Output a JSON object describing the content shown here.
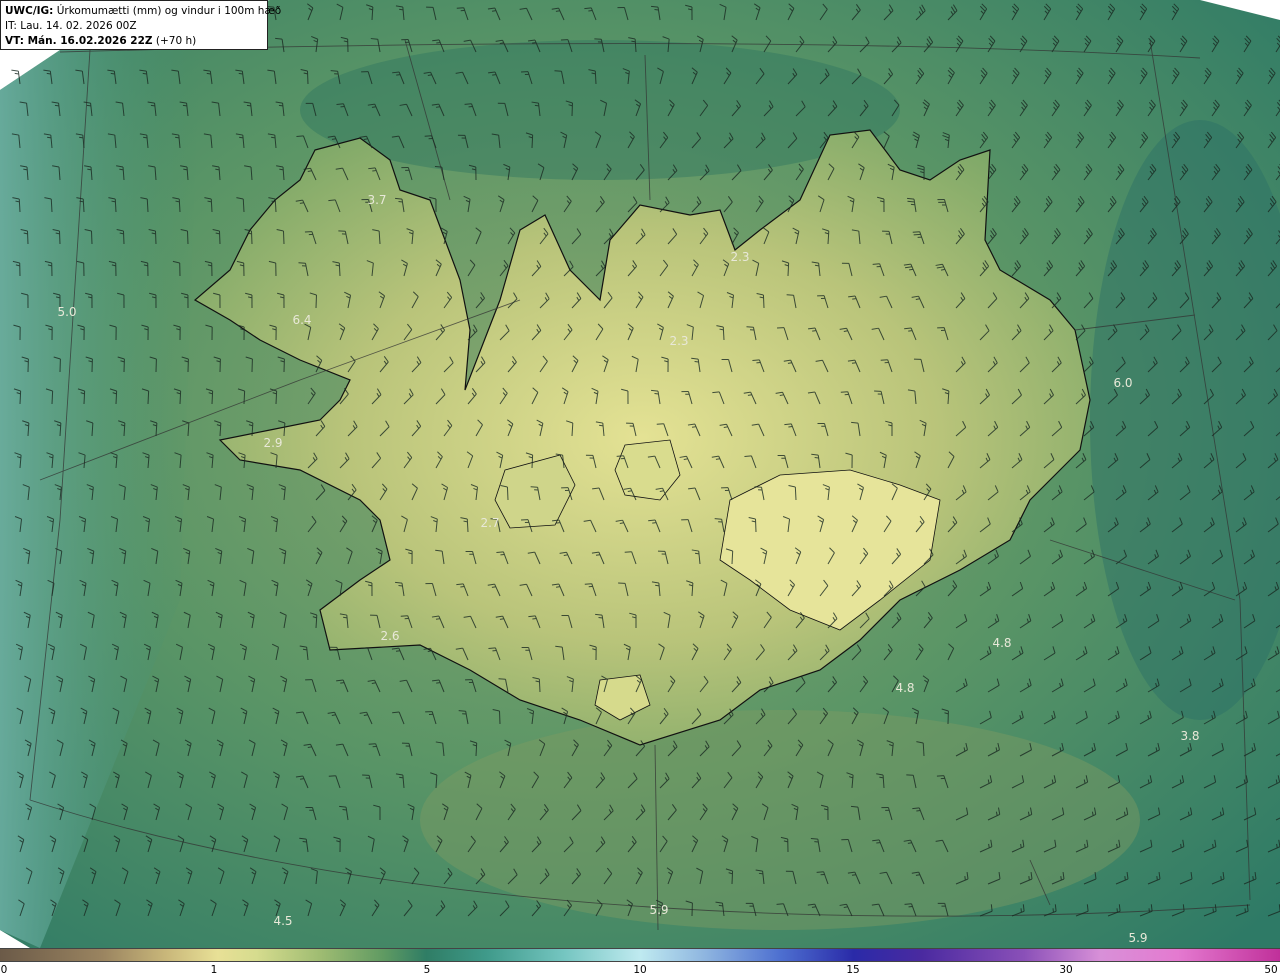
{
  "title": {
    "product": "UWC/IG:",
    "description": "Úrkomumætti (mm) og vindur i 100m hæð",
    "init_time": "IT: Lau. 14. 02. 2026 00Z",
    "valid_label": "VT: Mán. 16.02.2026 22Z",
    "lead_time": "(+70 h)"
  },
  "value_labels": [
    {
      "text": "3.7"
    },
    {
      "text": "5.0"
    },
    {
      "text": "6.4"
    },
    {
      "text": "2.3"
    },
    {
      "text": "2.3"
    },
    {
      "text": "6.0"
    },
    {
      "text": "2.9"
    },
    {
      "text": "2.7"
    },
    {
      "text": "2.6"
    },
    {
      "text": "4.8"
    },
    {
      "text": "4.8"
    },
    {
      "text": "3.8"
    },
    {
      "text": "4.5"
    },
    {
      "text": "5.9"
    },
    {
      "text": "5.9"
    }
  ],
  "colorbar": {
    "ticks": [
      "0",
      "1",
      "5",
      "10",
      "15",
      "30",
      "50"
    ]
  },
  "colors": {
    "sea_base": "#3d8a68",
    "land_high": "#e2e08e",
    "coastline": "#101010"
  }
}
